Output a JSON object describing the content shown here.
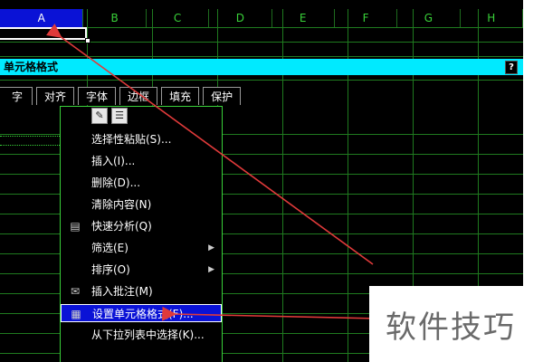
{
  "columns": [
    "A",
    "B",
    "C",
    "D",
    "E",
    "F",
    "G",
    "H"
  ],
  "selected_column": "A",
  "dialog_title": "单元格格式",
  "help_button": "?",
  "tabs": [
    "字",
    "对齐",
    "字体",
    "边框",
    "填充",
    "保护"
  ],
  "menu_toolbar_icons": [
    "paintbrush-icon",
    "clipboard-icon"
  ],
  "menu_items": [
    {
      "label": "选择性粘贴(S)...",
      "icon": "",
      "submenu": false,
      "highlighted": false
    },
    {
      "label": "插入(I)...",
      "icon": "",
      "submenu": false,
      "highlighted": false
    },
    {
      "label": "删除(D)...",
      "icon": "",
      "submenu": false,
      "highlighted": false
    },
    {
      "label": "清除内容(N)",
      "icon": "",
      "submenu": false,
      "highlighted": false
    },
    {
      "label": "快速分析(Q)",
      "icon": "quick-analysis-icon",
      "submenu": false,
      "highlighted": false
    },
    {
      "label": "筛选(E)",
      "icon": "",
      "submenu": true,
      "highlighted": false
    },
    {
      "label": "排序(O)",
      "icon": "",
      "submenu": true,
      "highlighted": false
    },
    {
      "label": "插入批注(M)",
      "icon": "comment-icon",
      "submenu": false,
      "highlighted": false
    },
    {
      "label": "设置单元格格式(F)...",
      "icon": "format-cells-icon",
      "submenu": false,
      "highlighted": true
    },
    {
      "label": "从下拉列表中选择(K)...",
      "icon": "",
      "submenu": false,
      "highlighted": false
    }
  ],
  "watermark": "软件技巧",
  "colors": {
    "accent_cyan": "#00eaff",
    "highlight_blue": "#0a12d6",
    "grid_green": "#1f7a1f",
    "arrow_red": "#e03a3a"
  }
}
